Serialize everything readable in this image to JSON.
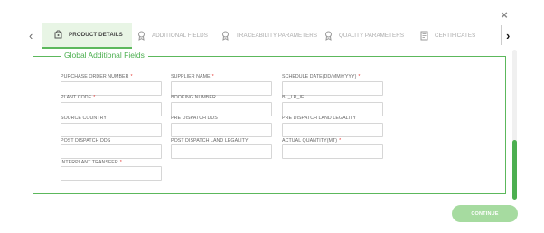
{
  "close_icon": "×",
  "tabs": [
    {
      "label": "PRODUCT DETAILS",
      "icon": "product-icon",
      "active": true
    },
    {
      "label": "ADDITIONAL FIELDS",
      "icon": "award-icon",
      "active": false
    },
    {
      "label": "TRACEABILITY PARAMETERS",
      "icon": "award-icon",
      "active": false
    },
    {
      "label": "QUALITY PARAMETERS",
      "icon": "award-icon",
      "active": false
    },
    {
      "label": "CERTIFICATES",
      "icon": "certificate-icon",
      "active": false
    }
  ],
  "nav": {
    "prev": "‹",
    "next": "›"
  },
  "section": {
    "title": "Global Additional Fields",
    "fields": [
      {
        "label": "PURCHASE ORDER NUMBER",
        "required": true,
        "value": ""
      },
      {
        "label": "SUPPLIER NAME",
        "required": true,
        "value": ""
      },
      {
        "label": "SCHEDULE DATE(DD/MM/YYYY)",
        "required": true,
        "value": ""
      },
      {
        "label": "PLANT CODE",
        "required": true,
        "value": ""
      },
      {
        "label": "BOOKING NUMBER",
        "required": false,
        "value": ""
      },
      {
        "label": "BL_LR_IF",
        "required": false,
        "value": ""
      },
      {
        "label": "SOURCE COUNTRY",
        "required": false,
        "value": ""
      },
      {
        "label": "PRE DISPATCH DDS",
        "required": false,
        "value": ""
      },
      {
        "label": "PRE DISPATCH LAND LEGALITY",
        "required": false,
        "value": ""
      },
      {
        "label": "POST DISPATCH DDS",
        "required": false,
        "value": ""
      },
      {
        "label": "POST DISPATCH LAND LEGALITY",
        "required": false,
        "value": ""
      },
      {
        "label": "ACTUAL QUANTITY(MT)",
        "required": true,
        "value": ""
      },
      {
        "label": "INTERPLANT TRANSFER",
        "required": true,
        "value": ""
      }
    ]
  },
  "continue_label": "CONTINUE",
  "required_marker": "*",
  "colors": {
    "accent": "#5cb85c",
    "required": "#e53935",
    "continue": "#a6dba0"
  }
}
